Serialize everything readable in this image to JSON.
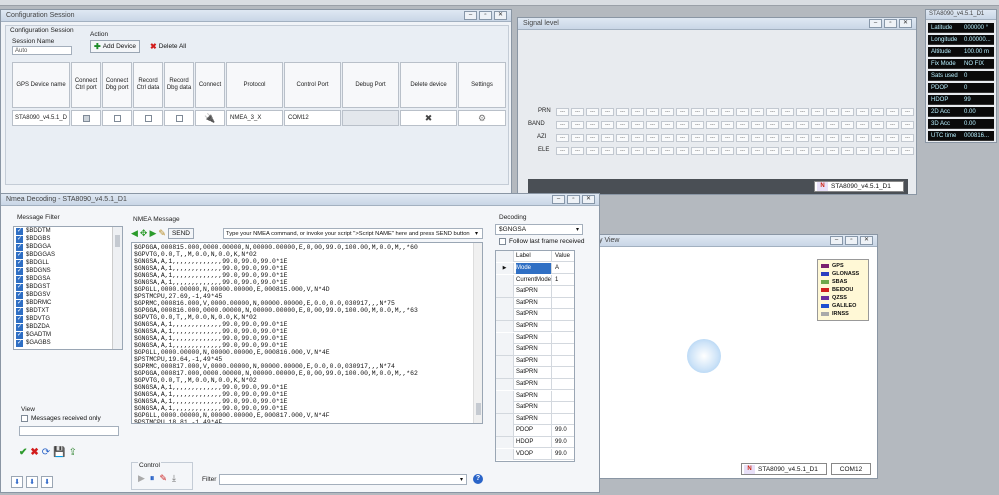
{
  "config": {
    "title": "Configuration Session",
    "group_label": "Configuration Session",
    "session_name_label": "Session Name",
    "session_name_value": "Auto",
    "action_label": "Action",
    "add_device": "Add Device",
    "delete_all": "Delete All",
    "columns": [
      "GPS Device name",
      "Connect Ctrl port",
      "Connect Dbg port",
      "Record Ctrl data",
      "Record Dbg data",
      "Connect",
      "Protocol",
      "Control Port",
      "Debug Port",
      "Delete device",
      "Settings"
    ],
    "row": {
      "device": "STA8090_v4.5.1_D",
      "protocol": "NMEA_3_X",
      "control_port": "COM12"
    }
  },
  "signal": {
    "title": "Signal level",
    "rows": [
      "PRN",
      "BAND",
      "AZI",
      "ELE"
    ],
    "box_value": "---",
    "device": "STA8090_v4.5.1_D1"
  },
  "status": {
    "title": "STA8090_v4.5.1_D1",
    "rows": [
      {
        "label": "Latitude",
        "value": "000000 °"
      },
      {
        "label": "Longitude",
        "value": "0.00000..."
      },
      {
        "label": "Altitude",
        "value": "100.00 m"
      },
      {
        "label": "Fix Mode",
        "value": "NO FIX"
      },
      {
        "label": "Sats used",
        "value": "0"
      },
      {
        "label": "PDOP",
        "value": "0"
      },
      {
        "label": "HDOP",
        "value": "99"
      },
      {
        "label": "2D Acc",
        "value": "0.00"
      },
      {
        "label": "3D Acc",
        "value": "0.00"
      },
      {
        "label": "UTC time",
        "value": "000816..."
      }
    ]
  },
  "sky": {
    "title": "y View",
    "legend": [
      {
        "name": "GPS",
        "color": "#7a1f6e"
      },
      {
        "name": "GLONASS",
        "color": "#2b3fbf"
      },
      {
        "name": "SBAS",
        "color": "#6fa84a"
      },
      {
        "name": "BEIDOU",
        "color": "#d01f1f"
      },
      {
        "name": "QZSS",
        "color": "#6a2fa0"
      },
      {
        "name": "GALILEO",
        "color": "#1f4fd0"
      },
      {
        "name": "IRNSS",
        "color": "#a9a9a9"
      }
    ],
    "device": "STA8090_v4.5.1_D1",
    "port": "COM12"
  },
  "nmea": {
    "title": "Nmea Decoding - STA8090_v4.5.1_D1",
    "filter_label": "Message Filter",
    "filters": [
      "$BDDTM",
      "$BDGBS",
      "$BDGGA",
      "$BDGGAS",
      "$BDGLL",
      "$BDGNS",
      "$BDGSA",
      "$BDGST",
      "$BDGSV",
      "$BDRMC",
      "$BDTXT",
      "$BDVTG",
      "$BDZDA",
      "$GADTM",
      "$GAGBS"
    ],
    "message_label": "NMEA Message",
    "send_label": "SEND",
    "command_placeholder": "Type your NMEA command, or invoke your script \">Script NAME\" here and press SEND button",
    "lines": [
      "$GPGGA,000815.000,0000.00000,N,00000.00000,E,0,00,99.0,100.00,M,0.0,M,,*60",
      "$GPVTG,0.0,T,,M,0.0,N,0.0,K,N*02",
      "$GNGSA,A,1,,,,,,,,,,,,,99.0,99.0,99.0*1E",
      "$GNGSA,A,1,,,,,,,,,,,,,99.0,99.0,99.0*1E",
      "$GNGSA,A,1,,,,,,,,,,,,,99.0,99.0,99.0*1E",
      "$GNGSA,A,1,,,,,,,,,,,,,99.0,99.0,99.0*1E",
      "$GPGLL,0000.00000,N,00000.00000,E,000815.000,V,N*4D",
      "$PSTMCPU,27.69,-1,49*45",
      "$GPRMC,000816.000,V,0000.00000,N,00000.00000,E,0.0,0.0,030917,,,N*75",
      "$GPGGA,000816.000,0000.00000,N,00000.00000,E,0,00,99.0,100.00,M,0.0,M,,*63",
      "$GPVTG,0.0,T,,M,0.0,N,0.0,K,N*02",
      "$GNGSA,A,1,,,,,,,,,,,,,99.0,99.0,99.0*1E",
      "$GNGSA,A,1,,,,,,,,,,,,,99.0,99.0,99.0*1E",
      "$GNGSA,A,1,,,,,,,,,,,,,99.0,99.0,99.0*1E",
      "$GNGSA,A,1,,,,,,,,,,,,,99.0,99.0,99.0*1E",
      "$GPGLL,0000.00000,N,00000.00000,E,000816.000,V,N*4E",
      "$PSTMCPU,19.64,-1,49*45",
      "$GPRMC,000817.000,V,0000.00000,N,00000.00000,E,0.0,0.0,030917,,,N*74",
      "$GPGGA,000817.000,0000.00000,N,00000.00000,E,0,00,99.0,100.00,M,0.0,M,,*62",
      "$GPVTG,0.0,T,,M,0.0,N,0.0,K,N*02",
      "$GNGSA,A,1,,,,,,,,,,,,,99.0,99.0,99.0*1E",
      "$GNGSA,A,1,,,,,,,,,,,,,99.0,99.0,99.0*1E",
      "$GNGSA,A,1,,,,,,,,,,,,,99.0,99.0,99.0*1E",
      "$GNGSA,A,1,,,,,,,,,,,,,99.0,99.0,99.0*1E",
      "$GPGLL,0000.00000,N,00000.00000,E,000817.000,V,N*4F",
      "$PSTMCPU,18.81,-1,49*4F"
    ],
    "view_label": "View",
    "messages_only_label": "Messages received only",
    "control_label": "Control",
    "filter_field_label": "Filter",
    "decoding_label": "Decoding",
    "decoding_value": "$GNGSA",
    "follow_label": "Follow last frame received",
    "table_header": {
      "label": "Label",
      "value": "Value"
    },
    "table_rows": [
      {
        "label": "Mode",
        "value": "A"
      },
      {
        "label": "CurrentMode",
        "value": "1"
      },
      {
        "label": "SatPRN",
        "value": ""
      },
      {
        "label": "SatPRN",
        "value": ""
      },
      {
        "label": "SatPRN",
        "value": ""
      },
      {
        "label": "SatPRN",
        "value": ""
      },
      {
        "label": "SatPRN",
        "value": ""
      },
      {
        "label": "SatPRN",
        "value": ""
      },
      {
        "label": "SatPRN",
        "value": ""
      },
      {
        "label": "SatPRN",
        "value": ""
      },
      {
        "label": "SatPRN",
        "value": ""
      },
      {
        "label": "SatPRN",
        "value": ""
      },
      {
        "label": "SatPRN",
        "value": ""
      },
      {
        "label": "SatPRN",
        "value": ""
      },
      {
        "label": "PDOP",
        "value": "99.0"
      },
      {
        "label": "HDOP",
        "value": "99.0"
      },
      {
        "label": "VDOP",
        "value": "99.0"
      }
    ]
  }
}
